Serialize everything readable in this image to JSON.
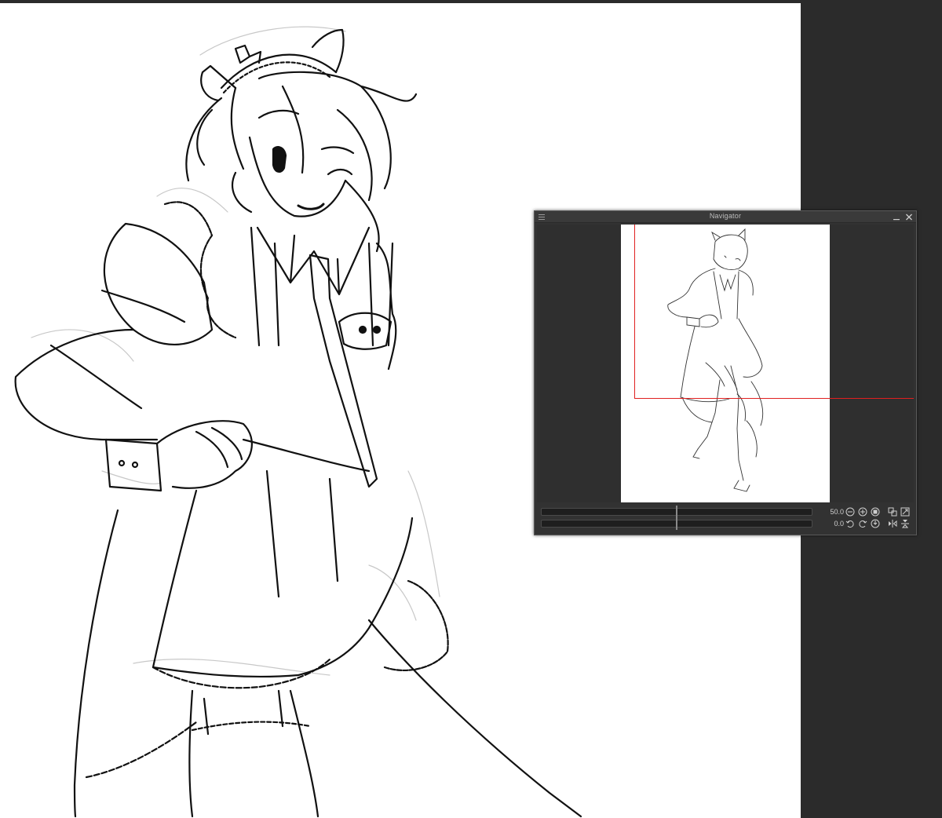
{
  "navigator": {
    "title": "Navigator",
    "zoom_value": "50.0",
    "rotation_value": "0.0",
    "zoom_slider_fraction": 0.5,
    "rotation_slider_fraction": 0.5,
    "viewport_color": "#e02020"
  },
  "canvas": {
    "background": "#ffffff",
    "artwork": "maid character line-art sketch"
  },
  "icons": {
    "panel_menu": "menu-icon",
    "minimize": "minimize-icon",
    "close": "close-icon",
    "zoom_out": "zoom-out-icon",
    "zoom_in": "zoom-in-icon",
    "fit": "fit-to-window-icon",
    "actual_size": "actual-size-icon",
    "fit_all": "fit-all-icon",
    "rotate_left": "rotate-left-icon",
    "rotate_right": "rotate-right-icon",
    "reset_rotation": "reset-rotation-icon",
    "flip_horizontal": "flip-horizontal-icon",
    "flip_vertical": "flip-vertical-icon"
  }
}
